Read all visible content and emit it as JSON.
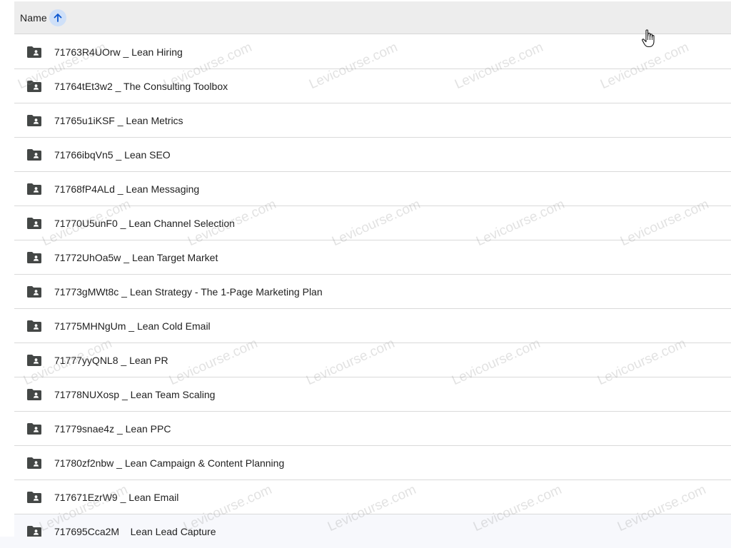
{
  "header": {
    "name_label": "Name",
    "sort_icon": "arrow-up-icon",
    "sort_active_color": "#cfe0f8"
  },
  "rows": [
    {
      "name": "71763R4UOrw _ Lean Hiring",
      "icon": "shared-folder-icon"
    },
    {
      "name": "71764tEt3w2 _ The Consulting Toolbox",
      "icon": "shared-folder-icon"
    },
    {
      "name": "71765u1iKSF _ Lean Metrics",
      "icon": "shared-folder-icon"
    },
    {
      "name": "71766ibqVn5 _ Lean SEO",
      "icon": "shared-folder-icon"
    },
    {
      "name": "71768fP4ALd _ Lean Messaging",
      "icon": "shared-folder-icon"
    },
    {
      "name": "71770U5unF0 _ Lean Channel Selection",
      "icon": "shared-folder-icon"
    },
    {
      "name": "71772UhOa5w _ Lean Target Market",
      "icon": "shared-folder-icon"
    },
    {
      "name": "71773gMWt8c _ Lean Strategy - The 1-Page Marketing Plan",
      "icon": "shared-folder-icon"
    },
    {
      "name": "71775MHNgUm _ Lean Cold Email",
      "icon": "shared-folder-icon"
    },
    {
      "name": "71777yyQNL8 _ Lean PR",
      "icon": "shared-folder-icon"
    },
    {
      "name": "71778NUXosp _ Lean Team Scaling",
      "icon": "shared-folder-icon"
    },
    {
      "name": "71779snae4z _ Lean PPC",
      "icon": "shared-folder-icon"
    },
    {
      "name": "71780zf2nbw _ Lean Campaign & Content Planning",
      "icon": "shared-folder-icon"
    },
    {
      "name": "717671EzrW9 _ Lean Email",
      "icon": "shared-folder-icon"
    },
    {
      "name": "717695Cca2M _ Lean Lead Capture",
      "icon": "shared-folder-icon"
    }
  ],
  "watermark": {
    "text": "Levicourse.com"
  },
  "colors": {
    "header_bg": "#ededed",
    "divider": "#dadada",
    "icon": "#444746",
    "text": "#1f1f1f"
  }
}
